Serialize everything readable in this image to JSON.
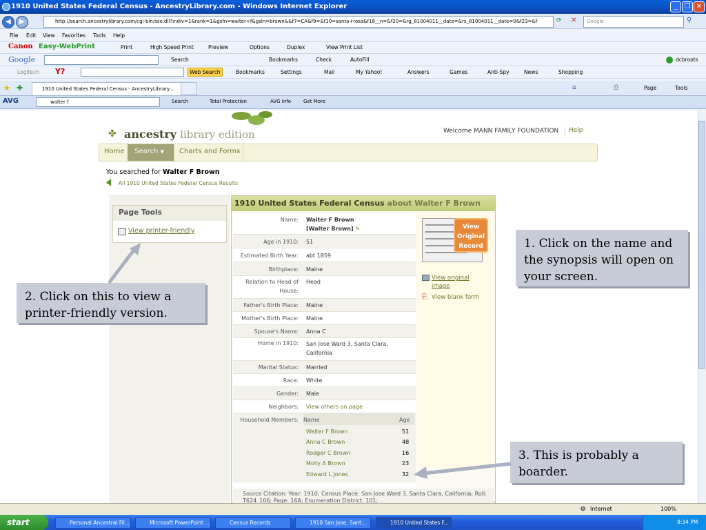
{
  "window": {
    "title": "1910 United States Federal Census - AncestryLibrary.com - Windows Internet Explorer"
  },
  "address": {
    "url": "http://search.ancestrylibrary.com/cgi-bin/sse.dll?indiv=1&rank=1&gsfn=walter+f&gsln=brown&&f7=CA&f9=&f10=santa+rosa&f18__n=&f20=&rg_81004011__date=&rs_81004011__date=0&f23=&f",
    "search_placeholder": "Google"
  },
  "menu": {
    "items": [
      "File",
      "Edit",
      "View",
      "Favorites",
      "Tools",
      "Help"
    ]
  },
  "canon_bar": {
    "brand": "Canon",
    "product": "Easy-WebPrint",
    "buttons": [
      "Print",
      "High Speed Print",
      "Preview",
      "Options",
      "Duplex",
      "View Print List"
    ]
  },
  "google_bar": {
    "brand": "Google",
    "search": "Search",
    "bookmarks": "Bookmarks",
    "check": "Check",
    "autofill": "AutoFill",
    "user": "dcbroots"
  },
  "yahoo_bar": {
    "logitech": "Logitech",
    "web_search": "Web Search",
    "items": [
      "Bookmarks",
      "Settings",
      "Mail",
      "My Yahoo!",
      "Answers",
      "Games",
      "Anti-Spy",
      "News",
      "Shopping"
    ]
  },
  "tabs": {
    "active": "1910 United States Federal Census - AncestryLibrary....",
    "page": "Page",
    "tools": "Tools"
  },
  "avg_bar": {
    "brand": "AVG",
    "search_value": "walter f",
    "search": "Search",
    "total": "Total Protection",
    "info": "AVG Info",
    "more": "Get More"
  },
  "page": {
    "logo_main": "ancestry",
    "logo_sub": "library edition",
    "welcome": "Welcome MANN FAMILY FOUNDATION",
    "help": "Help",
    "nav": [
      "Home",
      "Search",
      "Charts and Forms"
    ],
    "searched_prefix": "You searched for ",
    "searched_name": "Walter F Brown",
    "all_results": "All 1910 United States Federal Census Results",
    "page_tools": "Page Tools",
    "printer_friendly": "View printer-friendly",
    "record_title": "1910 United States Federal Census",
    "record_about": " about Walter F Brown",
    "name_line1": "Walter F Brown",
    "name_line2": "[Walter Brown]",
    "fields": [
      {
        "label": "Name:",
        "value": ""
      },
      {
        "label": "Age in 1910:",
        "value": "51"
      },
      {
        "label": "Estimated Birth Year:",
        "value": "abt 1859"
      },
      {
        "label": "Birthplace:",
        "value": "Maine"
      },
      {
        "label": "Relation to Head of House:",
        "value": "Head"
      },
      {
        "label": "Father's Birth Place:",
        "value": "Maine"
      },
      {
        "label": "Mother's Birth Place:",
        "value": "Maine"
      },
      {
        "label": "Spouse's Name:",
        "value": "Anna C"
      },
      {
        "label": "Home in 1910:",
        "value": "San Jose Ward 3, Santa Clara, California"
      },
      {
        "label": "Marital Status:",
        "value": "Married"
      },
      {
        "label": "Race:",
        "value": "White"
      },
      {
        "label": "Gender:",
        "value": "Male"
      },
      {
        "label": "Neighbors:",
        "value": "View others on page"
      }
    ],
    "household_label": "Household Members:",
    "hh_name": "Name",
    "hh_age": "Age",
    "household": [
      {
        "name": "Walter F Brown",
        "age": "51"
      },
      {
        "name": "Anna C Brown",
        "age": "48"
      },
      {
        "name": "Rodger C Brown",
        "age": "16"
      },
      {
        "name": "Molly A Brown",
        "age": "23"
      },
      {
        "name": "Edward L Jones",
        "age": "32"
      }
    ],
    "badge": "View Original Record",
    "view_original": "View original image",
    "view_blank": "View blank form",
    "source": "Source Citation: Year: 1910; Census Place: San Jose Ward 3, Santa Clara, California; Roll: T624_106; Page: 16A; Enumeration District: 101;"
  },
  "callouts": {
    "one": "1. Click on the name and the synopsis will open on your screen.",
    "two": "2. Click on this to view a printer-friendly version.",
    "three": "3. This is probably a boarder."
  },
  "status": {
    "zone": "Internet",
    "zoom": "100%"
  },
  "taskbar": {
    "start": "start",
    "tasks": [
      "Personal Ancestral Fil...",
      "Microsoft PowerPoint ...",
      "Census Records",
      "1910 San Jose, Sant...",
      "1910 United States F..."
    ],
    "time": "8:34 PM"
  }
}
